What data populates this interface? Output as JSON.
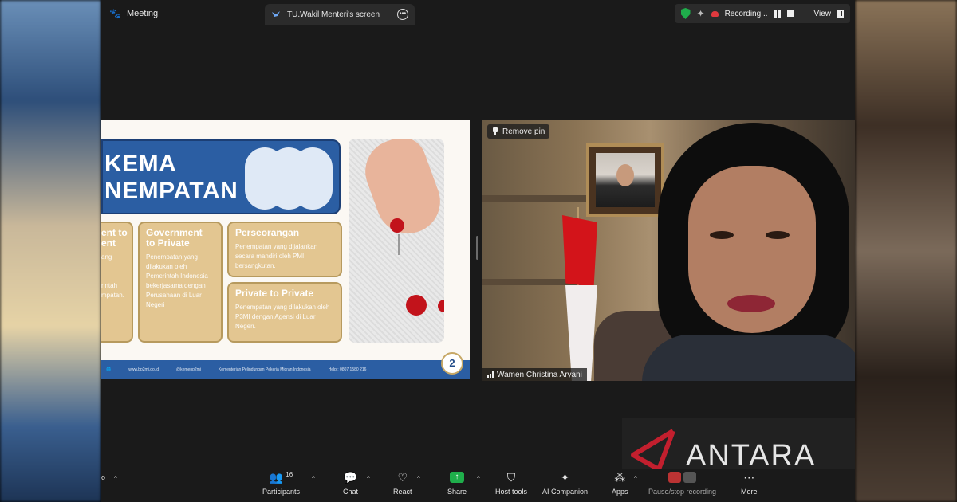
{
  "topbar": {
    "meeting_label": "Meeting",
    "screen_tab_label": "TU.Wakil Menteri's screen",
    "recording_label": "Recording...",
    "view_label": "View"
  },
  "slide": {
    "banner_line1": "KEMA",
    "banner_line2": "NEMPATAN",
    "cards": [
      {
        "title": "ent to\nent",
        "body": "ang\n\n\nrintah\nmpatan."
      },
      {
        "title": "Government\nto Private",
        "body": "Penempatan yang dilakukan oleh Pemerintah Indonesia bekerjasama dengan Perusahaan di Luar Negeri"
      },
      {
        "title": "Perseorangan",
        "body": "Penempatan yang dijalankan secara mandiri oleh PMI bersangkutan."
      },
      {
        "title": "Private to Private",
        "body": "Penempatan yang dilakukan oleh P3MI dengan Agensi di Luar Negeri."
      }
    ],
    "footer": {
      "website": "www.bp2mi.go.id",
      "social": "@kemenp2mi",
      "ministry": "Kementerian Pelindungan Pekerja Migran Indonesia",
      "hotline": "Help : 0807 1580 216"
    },
    "page_number": "2"
  },
  "video": {
    "remove_pin_label": "Remove pin",
    "participant_name": "Wamen Christina Aryani"
  },
  "watermark": {
    "text": "ANTARA"
  },
  "toolbar": {
    "left_cut_label": "o",
    "participants_label": "Participants",
    "participants_count": "16",
    "chat_label": "Chat",
    "react_label": "React",
    "share_label": "Share",
    "host_tools_label": "Host tools",
    "ai_companion_label": "AI Companion",
    "apps_label": "Apps",
    "recording_label": "Pause/stop recording",
    "more_label": "More"
  },
  "colors": {
    "zoom_bg": "#1a1a1a",
    "slide_blue": "#2b5ea3",
    "card_gold": "#e3c691",
    "share_green": "#1fae4b",
    "record_red": "#e0393e"
  }
}
